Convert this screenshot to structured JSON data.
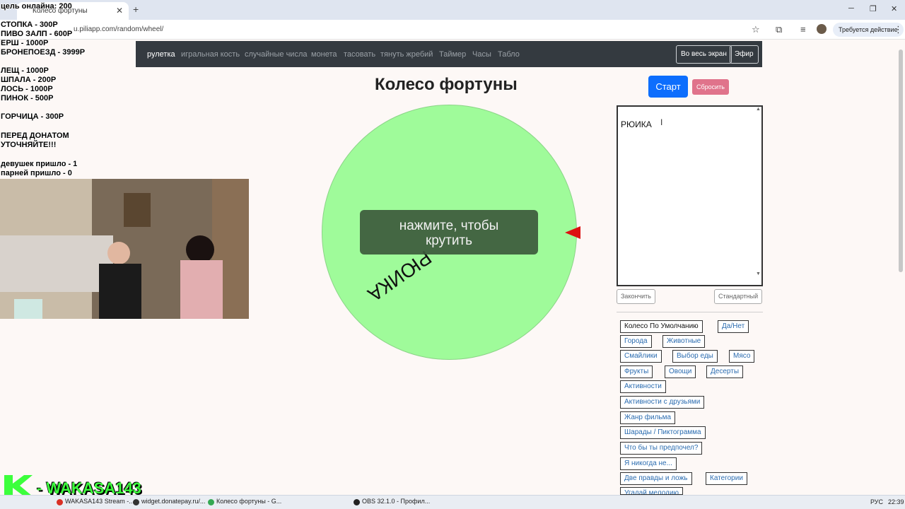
{
  "browser": {
    "tab_title": "Колесо фортуны",
    "url": "u.piliapp.com/random/wheel/",
    "action_required": "Требуется действие"
  },
  "nav": {
    "items": [
      "рулетка",
      "игральная кость",
      "случайные числа",
      "монета",
      "тасовать",
      "тянуть жребий",
      "Таймер",
      "Часы",
      "Табло"
    ],
    "fullscreen": "Во весь экран",
    "live": "Эфир"
  },
  "page": {
    "title": "Колесо фортуны",
    "start": "Старт",
    "reset": "Сбросить"
  },
  "wheel": {
    "entry_label": "РЮИКА",
    "overlay_line1": "нажмите, чтобы",
    "overlay_line2": "крутить",
    "color": "#9ffb9a"
  },
  "editor": {
    "text": "РЮИКА",
    "finish": "Закончить",
    "standard": "Стандартный"
  },
  "presets": [
    "Колесо По Умолчанию",
    "Да/Нет",
    "Города",
    "Животные",
    "Смайлики",
    "Выбор еды",
    "Мясо",
    "Фрукты",
    "Овощи",
    "Десерты",
    "Активности",
    "Активности с друзьями",
    "Жанр фильма",
    "Шарады / Пиктограмма",
    "Что бы ты предпочел?",
    "Я никогда не...",
    "Две правды и ложь",
    "Категории",
    "Угадай мелодию"
  ],
  "stream_overlay": {
    "goal": "цель онлайна: 200",
    "prices": [
      "СТОПКА - 300Р",
      "ПИВО ЗАЛП - 600Р",
      "ЕРШ - 1000Р",
      "БРОНЕПОЕЗД - 3999Р",
      "ЛЕЩ - 1000Р",
      "ШПАЛА - 200Р",
      "ЛОСЬ - 1000Р",
      "ПИНОК - 500Р",
      "ГОРЧИЦА - 300Р"
    ],
    "note1": "ПЕРЕД ДОНАТОМ",
    "note2": "УТОЧНЯЙТЕ!!!",
    "girls": "девушек пришло - 1",
    "guys": "парней пришло - 0",
    "channel": "- WAKASA143"
  },
  "taskbar": {
    "tasks": [
      "WAKASA143 Stream -...",
      "widget.donatepay.ru/...",
      "Колесо фортуны - G...",
      "OBS 32.1.0 - Профил..."
    ],
    "lang": "РУС",
    "time": "22:39"
  }
}
